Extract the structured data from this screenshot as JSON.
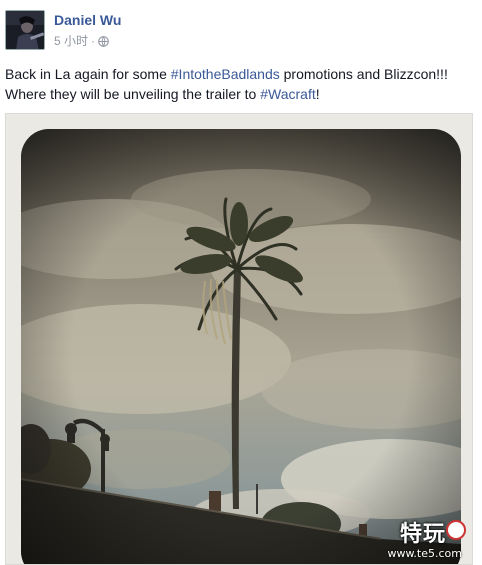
{
  "post": {
    "author": "Daniel Wu",
    "time": "5 小时",
    "separator": "·",
    "text_before": "Back in La again for some ",
    "hashtag1": "#IntotheBadlands",
    "text_middle": " promotions and Blizzcon!!! Where they will be unveiling the trailer to ",
    "hashtag2": "#Wacraft",
    "text_after": "!"
  },
  "watermark": {
    "brand": "特玩",
    "url": "www.te5.com"
  },
  "colors": {
    "link": "#3b5998",
    "text": "#141823",
    "muted": "#9197a3"
  }
}
